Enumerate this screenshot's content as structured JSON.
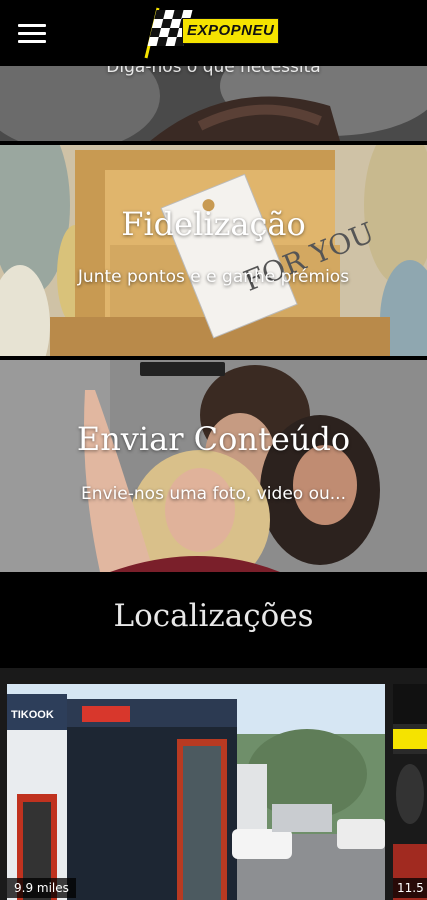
{
  "header": {
    "brand": "EXPOPNEU",
    "menu_icon": "hamburger-menu-icon"
  },
  "sections": [
    {
      "subtitle": "Diga-nos o que necessita"
    },
    {
      "title": "Fidelização",
      "subtitle": "Junte pontos e e ganhe prémios",
      "tag_text": "FOR YOU"
    },
    {
      "title": "Enviar Conteúdo",
      "subtitle": "Envie-nos uma foto, video ou..."
    }
  ],
  "locations": {
    "title": "Localizações",
    "cards": [
      {
        "distance": "9.9 miles",
        "sign_text": "TIKOOK"
      },
      {
        "distance": "11.5"
      }
    ]
  },
  "colors": {
    "brand_yellow": "#f5e300",
    "background": "#000000"
  }
}
